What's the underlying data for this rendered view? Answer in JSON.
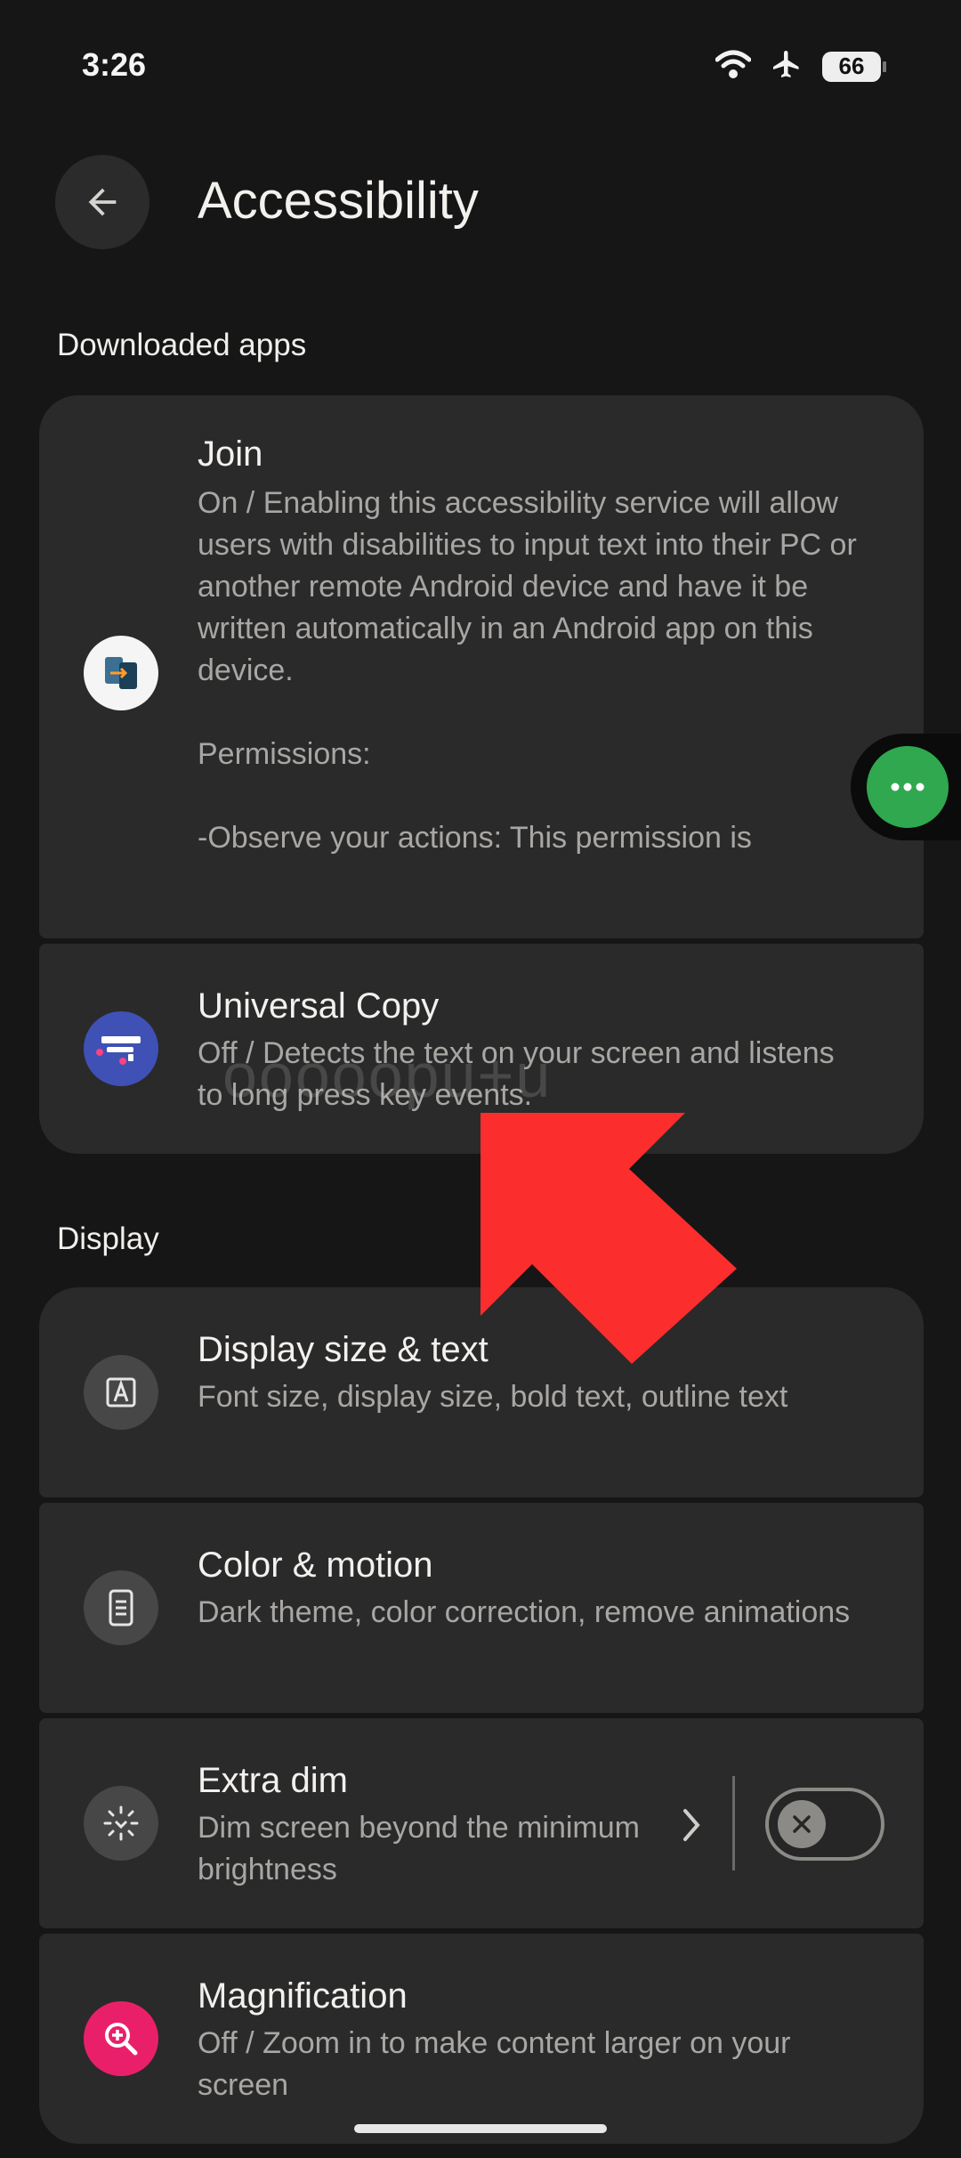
{
  "status_bar": {
    "time": "3:26",
    "battery": "66",
    "icons": [
      "wifi-icon",
      "airplane-icon",
      "battery-icon"
    ]
  },
  "header": {
    "title": "Accessibility"
  },
  "sections": {
    "downloaded_apps": "Downloaded apps",
    "display": "Display"
  },
  "downloaded_apps": [
    {
      "title": "Join",
      "subtitle": "On / Enabling this accessibility service will allow users with disabilities to input text into their PC or another remote Android device and have it be written automatically in an Android app on this device.\n\nPermissions:\n\n-Observe your actions: This permission is",
      "icon": "join-app-icon"
    },
    {
      "title": "Universal Copy",
      "subtitle": "Off / Detects the text on your screen and listens to long press key events.",
      "icon": "universal-copy-app-icon"
    }
  ],
  "display": [
    {
      "title": "Display size & text",
      "subtitle": "Font size, display size, bold text, outline text",
      "icon": "text-size-icon"
    },
    {
      "title": "Color & motion",
      "subtitle": "Dark theme, color correction, remove animations",
      "icon": "color-motion-icon"
    },
    {
      "title": "Extra dim",
      "subtitle": "Dim screen beyond the minimum brightness",
      "icon": "extra-dim-icon",
      "toggle_on": false
    },
    {
      "title": "Magnification",
      "subtitle": "Off / Zoom in to make content larger on your screen",
      "icon": "magnification-icon"
    }
  ],
  "overlay": {
    "watermark": "ooooopu+u",
    "floating_button_icon": "more-dots-icon",
    "arrow_color": "#fb2d2d"
  },
  "colors": {
    "background": "#161616",
    "card": "#2a2a2a",
    "fab": "#2fa84f",
    "magnification_icon_bg": "#ea1f6a"
  }
}
